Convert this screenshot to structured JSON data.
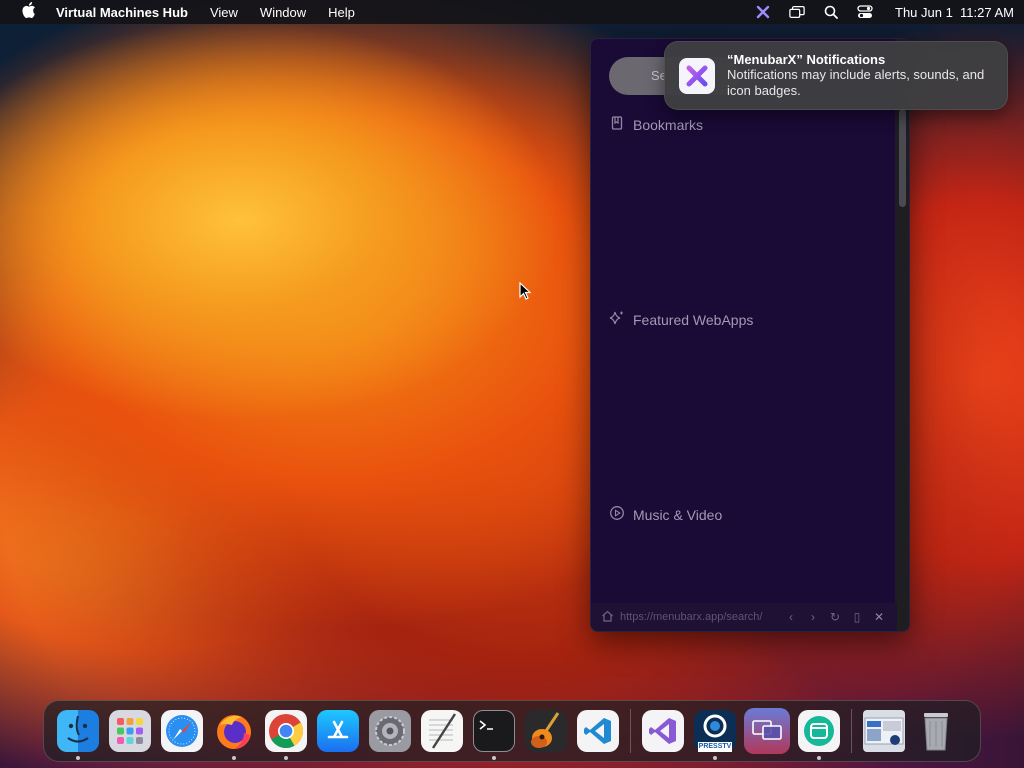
{
  "menubar": {
    "apple_icon": "apple-logo",
    "app_name": "Virtual Machines Hub",
    "menus": [
      "View",
      "Window",
      "Help"
    ],
    "status_icons": [
      "menubarx-icon",
      "screen-mirroring-icon",
      "spotlight-search-icon",
      "control-center-icon"
    ],
    "clock": "Thu Jun 1  11:27 AM"
  },
  "notification": {
    "title": "“MenubarX” Notifications",
    "body": "Notifications may include alerts, sounds, and icon badges.",
    "icon": "menubarx-app-icon"
  },
  "panel": {
    "search_text": "Se",
    "sections": [
      {
        "label": "Bookmarks",
        "icon": "bookmark-icon"
      },
      {
        "label": "Featured WebApps",
        "icon": "sparkle-icon"
      },
      {
        "label": "Music & Video",
        "icon": "play-circle-icon"
      }
    ],
    "footer": {
      "url": "https://menubarx.app/search/",
      "buttons": [
        "back-icon",
        "forward-icon",
        "reload-icon",
        "mobile-icon",
        "close-icon"
      ]
    }
  },
  "dock": {
    "apps": [
      {
        "name": "Finder",
        "running": true
      },
      {
        "name": "Launchpad",
        "running": false
      },
      {
        "name": "Safari",
        "running": false
      },
      {
        "name": "Firefox",
        "running": true
      },
      {
        "name": "Chrome",
        "running": true
      },
      {
        "name": "App Store",
        "running": false
      },
      {
        "name": "System Settings",
        "running": false
      },
      {
        "name": "TextEdit",
        "running": false
      },
      {
        "name": "Terminal",
        "running": true
      },
      {
        "name": "GarageBand",
        "running": false
      },
      {
        "name": "Visual Studio Code",
        "running": false
      },
      {
        "name": "Visual Studio",
        "running": false
      },
      {
        "name": "Press TV",
        "running": true,
        "label": "PRESSTV"
      },
      {
        "name": "Screen Sharing",
        "running": false
      },
      {
        "name": "MenubarX App",
        "running": true
      },
      {
        "name": "Desktop Preview",
        "running": false
      },
      {
        "name": "Trash",
        "running": false
      }
    ]
  }
}
